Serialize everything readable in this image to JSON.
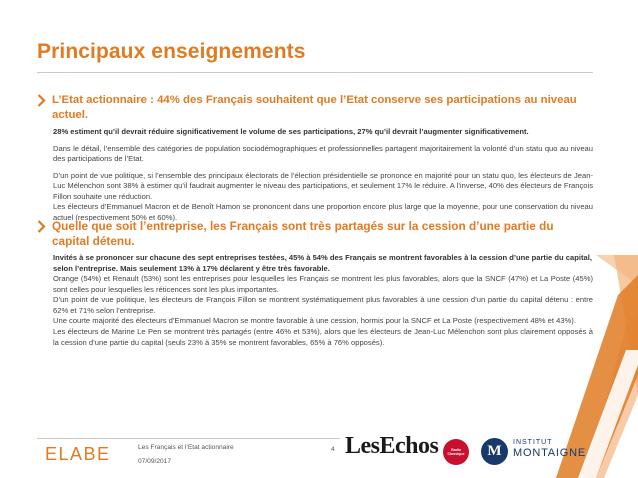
{
  "title": "Principaux enseignements",
  "section1": {
    "headline": "L’Etat actionnaire : 44% des Français souhaitent que l’Etat conserve ses participations au niveau actuel.",
    "bold": "28% estiment qu’il devrait réduire significativement le volume de ses participations, 27% qu’il devrait l’augmenter significativement.",
    "p1": "Dans le détail, l’ensemble des catégories de population sociodémographiques et professionnelles partagent majoritairement la volonté d’un statu quo au niveau des participations de l’Etat.",
    "p2": "D’un point de vue politique, si l’ensemble des principaux électorats de l’élection présidentielle se prononce en majorité pour un statu quo, les électeurs de Jean-Luc Mélenchon sont 38% à estimer qu’il faudrait augmenter le niveau des participations, et seulement 17% le réduire. A l’inverse, 40% des électeurs de François Fillon souhaite une réduction.",
    "p3": "Les électeurs d’Emmanuel Macron et de Benoît Hamon se prononcent dans une proportion encore plus large que la moyenne, pour une conservation du niveau actuel (respectivement 50% et 60%)."
  },
  "section2": {
    "headline": "Quelle que soit l’entreprise, les Français sont très partagés sur la cession d’une partie du capital détenu.",
    "bold": "Invités à se prononcer sur chacune des sept entreprises testées, 45% à 54% des Français se montrent favorables à la cession d’une partie du capital, selon l’entreprise. Mais seulement 13% à 17% déclarent y être très favorable.",
    "p1": "Orange (54%) et Renault (53%) sont les entreprises pour lesquelles les Français se montrent les plus favorables, alors que la SNCF (47%) et La Poste (45%) sont celles pour lesquelles les réticences sont les plus importantes.",
    "p2": "D’un point de vue politique, les électeurs de François Fillon se montrent systématiquement plus favorables à une cession d’un partie du capital détenu : entre 62% et 71% selon l’entreprise.",
    "p3": "Une courte majorité des électeurs d’Emmanuel Macron se montre favorable à une cession, hormis pour la SNCF et La Poste (respectivement 48% et 43%).",
    "p4": "Les électeurs de Marine  Le Pen se montrent très partagés (entre 46% et 53%), alors que les électeurs de Jean-Luc Mélenchon sont plus clairement opposés à la cession d’une partie du capital (seuls 23% à 35% se montrent favorables, 65% à 76% opposés)."
  },
  "footer": {
    "brand": "ELABE",
    "study": "Les Français et l’Etat actionnaire",
    "date": "07/09/2017",
    "page": "4",
    "partner1": "LesEchos",
    "partner2": "Radio Classique",
    "partner3_mark": "M",
    "partner3_line1": "INSTITUT",
    "partner3_line2": "MONTAIGNE"
  },
  "colors": {
    "accent": "#e07b24",
    "text": "#444444",
    "navy": "#173a6b",
    "red": "#c8102e"
  }
}
